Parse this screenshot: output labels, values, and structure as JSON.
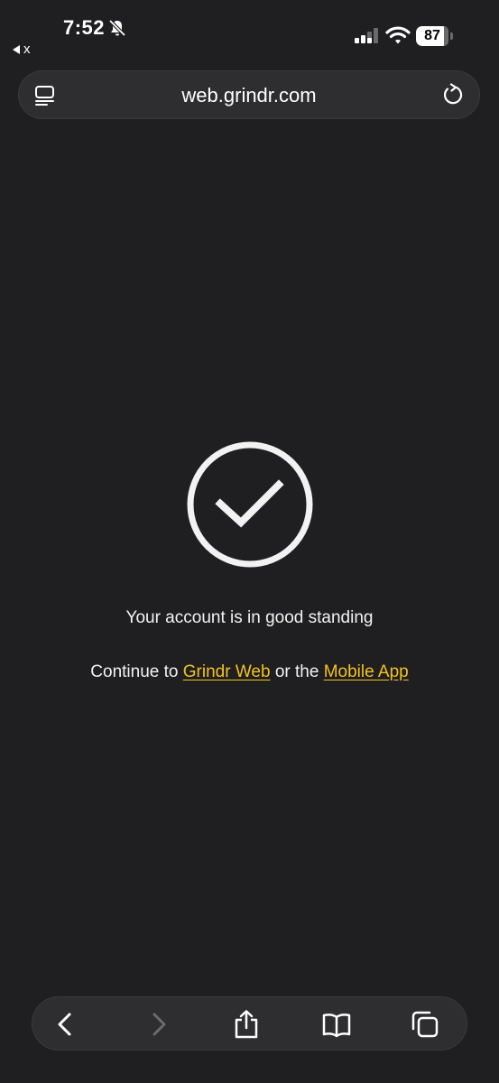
{
  "status_bar": {
    "time": "7:52",
    "back_app_label": "x",
    "battery_level": "87",
    "icons": [
      "bell-slash-icon",
      "signal-icon",
      "wifi-icon",
      "battery-icon"
    ]
  },
  "address_bar": {
    "url": "web.grindr.com",
    "icons": [
      "reader-mode-icon",
      "reload-icon"
    ]
  },
  "main": {
    "icon": "check-circle-icon",
    "standing_text": "Your account is in good standing",
    "continue_prefix": "Continue to ",
    "grindr_web_link": "Grindr Web",
    "continue_middle": " or the ",
    "mobile_app_link": "Mobile App"
  },
  "toolbar": {
    "icons": [
      "back-icon",
      "forward-icon",
      "share-icon",
      "bookmarks-icon",
      "tabs-icon"
    ]
  },
  "colors": {
    "background": "#1f1f21",
    "link": "#f4c21b",
    "bar": "#2e2e30"
  }
}
